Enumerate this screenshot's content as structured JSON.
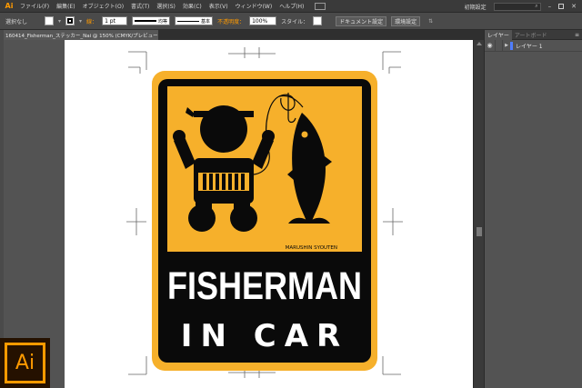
{
  "app": {
    "logo_text": "Ai",
    "menu": [
      "ファイル(F)",
      "編集(E)",
      "オブジェクト(O)",
      "書式(T)",
      "選択(S)",
      "効果(C)",
      "表示(V)",
      "ウィンドウ(W)",
      "ヘルプ(H)"
    ],
    "workspace": "初期設定",
    "big_logo_text": "Ai"
  },
  "control": {
    "selection": "選択なし",
    "stroke_label": "線：",
    "stroke_weight": "1 pt",
    "profile1": "均等",
    "profile2": "基本",
    "opacity_label": "不透明度：",
    "opacity_value": "100%",
    "style_label": "スタイル：",
    "doc_setup": "ドキュメント設定",
    "prefs": "環境設定"
  },
  "document": {
    "tab_title": "160414_Fisherman_ステッカー_Nai @ 150% (CMYK/プレビュー)",
    "close": "×"
  },
  "panel": {
    "tabs": [
      "レイヤー",
      "アートボード"
    ],
    "layers": [
      {
        "name": "レイヤー 1"
      }
    ]
  },
  "artwork": {
    "title": "FISHERMAN",
    "subtitle": "IN CAR",
    "credit": "MARUSHIN SYOUTEN",
    "colors": {
      "orange": "#f6b02b",
      "black": "#0a0a0a",
      "white": "#ffffff"
    }
  }
}
